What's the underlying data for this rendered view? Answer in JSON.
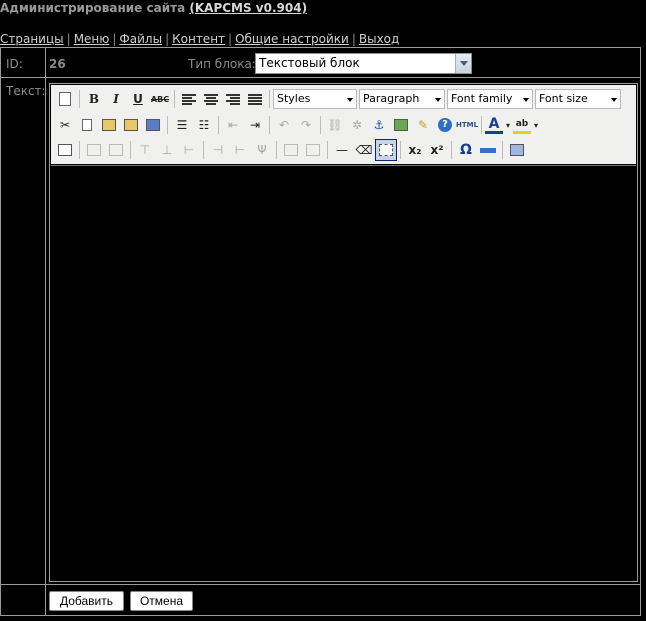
{
  "header": {
    "title": "Администрирование сайта",
    "version": "(KAPCMS v0.904)"
  },
  "nav": {
    "items": [
      "Страницы",
      "Меню",
      "Файлы",
      "Контент",
      "Общие настройки",
      "Выход"
    ]
  },
  "form": {
    "id_label": "ID:",
    "id_value": "26",
    "type_label": "Тип блока:",
    "type_value": "Текстовый блок",
    "text_label": "Текст:"
  },
  "editor": {
    "styles_label": "Styles",
    "paragraph_label": "Paragraph",
    "fontfamily_label": "Font family",
    "fontsize_label": "Font size",
    "bold_glyph": "B",
    "italic_glyph": "I",
    "underline_glyph": "U",
    "strike_glyph": "ABC",
    "html_glyph": "HTML",
    "forecolor_glyph": "A",
    "backcolor_glyph": "ab",
    "sub_glyph": "x₂",
    "sup_glyph": "x²",
    "charmap_glyph": "Ω"
  },
  "buttons": {
    "add": "Добавить",
    "cancel": "Отмена"
  }
}
